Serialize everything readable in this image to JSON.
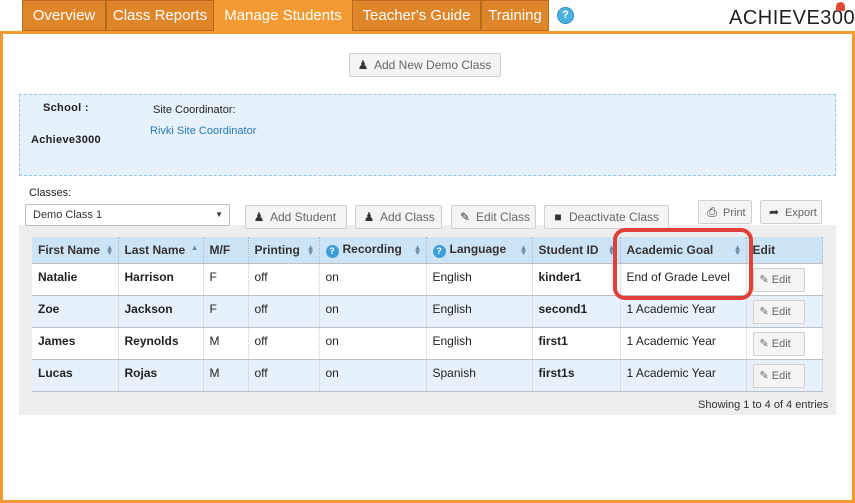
{
  "nav": {
    "tabs": [
      {
        "label": "Overview",
        "active": false
      },
      {
        "label": "Class Reports",
        "active": false
      },
      {
        "label": "Manage Students",
        "active": true
      },
      {
        "label": "Teacher's Guide",
        "active": false
      },
      {
        "label": "Training",
        "active": false
      }
    ],
    "help_icon": "?",
    "logo_text": "ACHIEVE3000"
  },
  "add_demo_class_label": "Add New Demo Class",
  "school_panel": {
    "school_label": "School :",
    "school_value": "Achieve3000",
    "coordinator_label": "Site Coordinator:",
    "coordinator_value": "Rivki Site Coordinator"
  },
  "classes": {
    "label": "Classes:",
    "selected": "Demo Class 1"
  },
  "toolbar": {
    "add_student": "Add Student",
    "add_class": "Add Class",
    "edit_class": "Edit Class",
    "deactivate_class": "Deactivate Class",
    "print": "Print",
    "export": "Export"
  },
  "table": {
    "headers": [
      "First Name",
      "Last Name",
      "M/F",
      "Printing",
      "Recording",
      "Language",
      "Student ID",
      "Academic Goal",
      "Edit"
    ],
    "rows": [
      {
        "first": "Natalie",
        "last": "Harrison",
        "mf": "F",
        "printing": "off",
        "recording": "on",
        "language": "English",
        "id": "kinder1",
        "goal": "End of Grade Level",
        "edit": "Edit"
      },
      {
        "first": "Zoe",
        "last": "Jackson",
        "mf": "F",
        "printing": "off",
        "recording": "on",
        "language": "English",
        "id": "second1",
        "goal": "1 Academic Year",
        "edit": "Edit"
      },
      {
        "first": "James",
        "last": "Reynolds",
        "mf": "M",
        "printing": "off",
        "recording": "on",
        "language": "English",
        "id": "first1",
        "goal": "1 Academic Year",
        "edit": "Edit"
      },
      {
        "first": "Lucas",
        "last": "Rojas",
        "mf": "M",
        "printing": "off",
        "recording": "on",
        "language": "Spanish",
        "id": "first1s",
        "goal": "1 Academic Year",
        "edit": "Edit"
      }
    ]
  },
  "entries_text": "Showing 1 to 4 of 4 entries",
  "colors": {
    "tab_orange": "#e0862a",
    "tab_active": "#f39a33",
    "header_blue": "#cde4f6",
    "highlight_red": "#e0403a"
  }
}
